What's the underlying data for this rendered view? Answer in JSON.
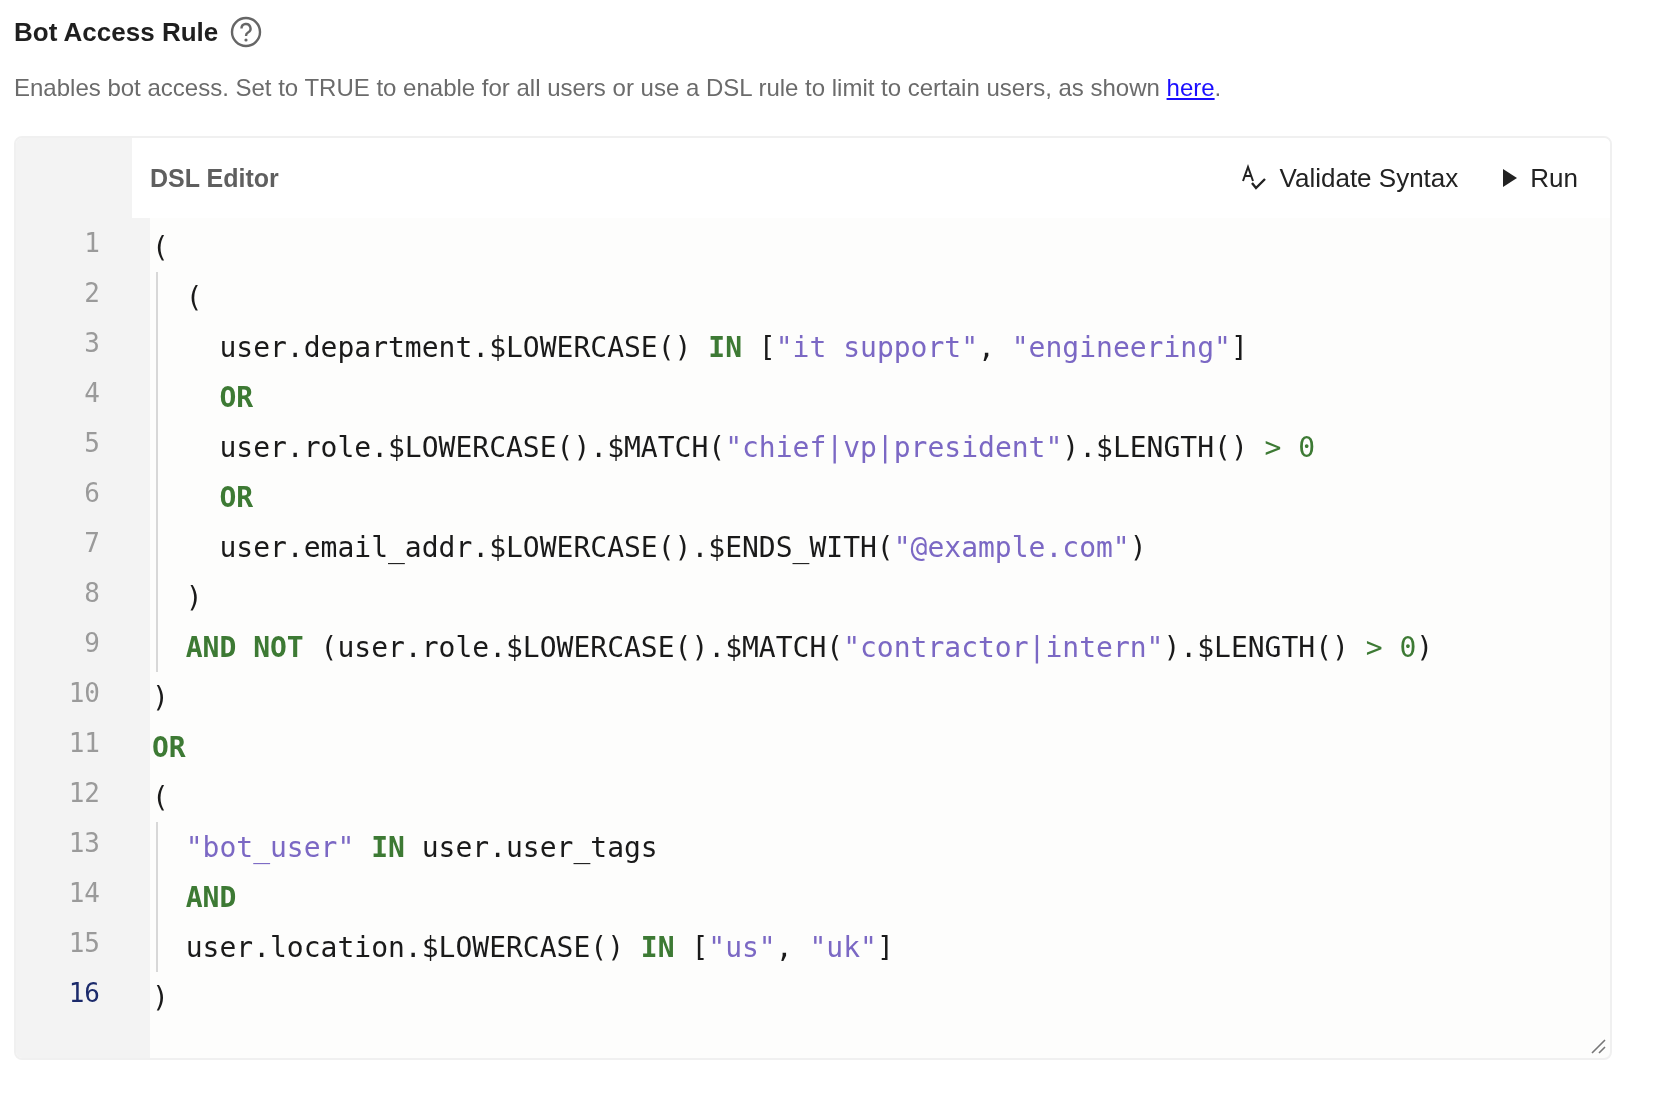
{
  "field": {
    "title": "Bot Access Rule",
    "description": {
      "text": "Enables bot access. Set to TRUE to enable for all users or use a DSL rule to limit to certain users, as shown ",
      "link": "here",
      "after": "."
    }
  },
  "editor": {
    "title": "DSL Editor",
    "actions": [
      {
        "kind": "validate",
        "label": "Validate Syntax"
      },
      {
        "kind": "run",
        "label": "Run"
      }
    ],
    "lines": [
      {
        "number": "1",
        "active": false,
        "tokens": [
          {
            "kind": "plain",
            "text": "("
          }
        ]
      },
      {
        "number": "2",
        "active": false,
        "tokens": [
          {
            "kind": "plain",
            "text": "  ("
          }
        ]
      },
      {
        "number": "3",
        "active": false,
        "tokens": [
          {
            "kind": "plain",
            "text": "    user.department.$LOWERCASE() "
          },
          {
            "kind": "keyword",
            "text": "IN"
          },
          {
            "kind": "plain",
            "text": " ["
          },
          {
            "kind": "string",
            "text": "\"it support\""
          },
          {
            "kind": "plain",
            "text": ", "
          },
          {
            "kind": "string",
            "text": "\"engineering\""
          },
          {
            "kind": "plain",
            "text": "]"
          }
        ]
      },
      {
        "number": "4",
        "active": false,
        "tokens": [
          {
            "kind": "keyword",
            "text": "    OR"
          }
        ]
      },
      {
        "number": "5",
        "active": false,
        "tokens": [
          {
            "kind": "plain",
            "text": "    user.role.$LOWERCASE().$MATCH("
          },
          {
            "kind": "string",
            "text": "\"chief|vp|president\""
          },
          {
            "kind": "plain",
            "text": ").$LENGTH() "
          },
          {
            "kind": "operator",
            "text": ">"
          },
          {
            "kind": "number",
            "text": " 0"
          }
        ]
      },
      {
        "number": "6",
        "active": false,
        "tokens": [
          {
            "kind": "keyword",
            "text": "    OR"
          }
        ]
      },
      {
        "number": "7",
        "active": false,
        "tokens": [
          {
            "kind": "plain",
            "text": "    user.email_addr.$LOWERCASE().$ENDS_WITH("
          },
          {
            "kind": "string",
            "text": "\"@example.com\""
          },
          {
            "kind": "plain",
            "text": ")"
          }
        ]
      },
      {
        "number": "8",
        "active": false,
        "tokens": [
          {
            "kind": "plain",
            "text": "  )"
          }
        ]
      },
      {
        "number": "9",
        "active": false,
        "tokens": [
          {
            "kind": "keyword",
            "text": "  AND NOT"
          },
          {
            "kind": "plain",
            "text": " (user.role.$LOWERCASE().$MATCH("
          },
          {
            "kind": "string",
            "text": "\"contractor|intern\""
          },
          {
            "kind": "plain",
            "text": ").$LENGTH() "
          },
          {
            "kind": "operator",
            "text": ">"
          },
          {
            "kind": "number",
            "text": " 0"
          },
          {
            "kind": "plain",
            "text": ")"
          }
        ]
      },
      {
        "number": "10",
        "active": false,
        "tokens": [
          {
            "kind": "plain",
            "text": ")"
          }
        ]
      },
      {
        "number": "11",
        "active": false,
        "tokens": [
          {
            "kind": "keyword",
            "text": "OR"
          }
        ]
      },
      {
        "number": "12",
        "active": false,
        "tokens": [
          {
            "kind": "plain",
            "text": "("
          }
        ]
      },
      {
        "number": "13",
        "active": false,
        "tokens": [
          {
            "kind": "string",
            "text": "  \"bot_user\""
          },
          {
            "kind": "keyword",
            "text": " IN"
          },
          {
            "kind": "plain",
            "text": " user.user_tags"
          }
        ]
      },
      {
        "number": "14",
        "active": false,
        "tokens": [
          {
            "kind": "keyword",
            "text": "  AND"
          }
        ]
      },
      {
        "number": "15",
        "active": false,
        "tokens": [
          {
            "kind": "plain",
            "text": "  user.location.$LOWERCASE() "
          },
          {
            "kind": "keyword",
            "text": "IN"
          },
          {
            "kind": "plain",
            "text": " ["
          },
          {
            "kind": "string",
            "text": "\"us\""
          },
          {
            "kind": "plain",
            "text": ", "
          },
          {
            "kind": "string",
            "text": "\"uk\""
          },
          {
            "kind": "plain",
            "text": "]"
          }
        ]
      },
      {
        "number": "16",
        "active": true,
        "tokens": [
          {
            "kind": "plain",
            "text": ")"
          }
        ]
      }
    ]
  }
}
